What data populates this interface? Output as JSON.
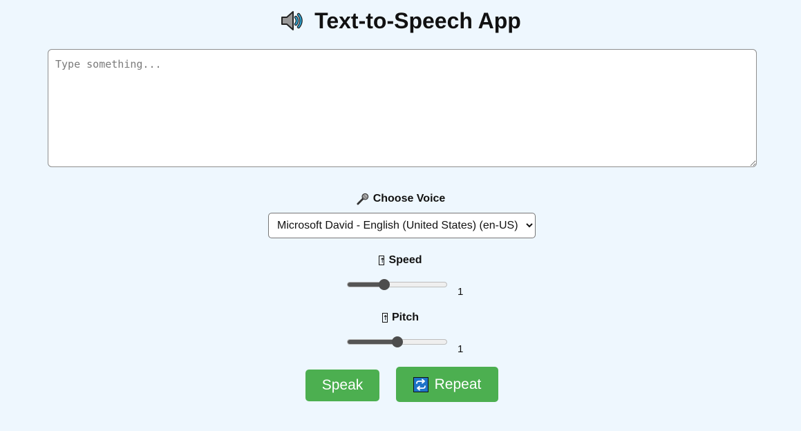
{
  "header": {
    "title": "Text-to-Speech App",
    "icon": "speaker-icon"
  },
  "text_input": {
    "value": "",
    "placeholder": "Type something..."
  },
  "voice": {
    "label": "Choose Voice",
    "icon": "microphone-icon",
    "selected": "Microsoft David - English (United States) (en-US)",
    "options": [
      "Microsoft David - English (United States) (en-US)"
    ]
  },
  "speed": {
    "label": "Speed",
    "icon": "slider-icon",
    "value": "1",
    "fill_fraction": 0.37
  },
  "pitch": {
    "label": "Pitch",
    "icon": "slider-icon",
    "value": "1",
    "fill_fraction": 0.5
  },
  "buttons": {
    "speak": "Speak",
    "repeat": "Repeat",
    "repeat_icon": "repeat-icon"
  },
  "colors": {
    "background": "#eef7fe",
    "button": "#4caf50",
    "repeat_icon_bg": "#1e74c8"
  }
}
